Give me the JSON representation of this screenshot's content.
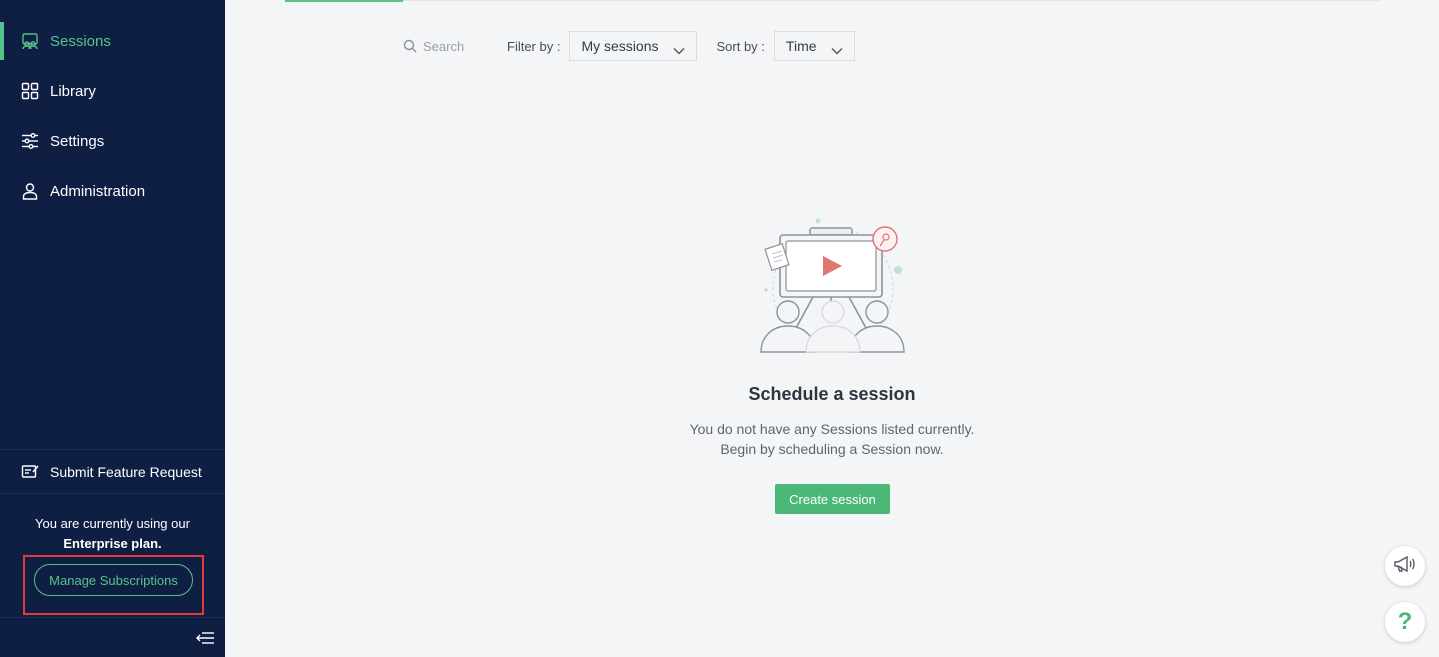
{
  "sidebar": {
    "items": [
      {
        "label": "Sessions",
        "icon": "sessions-icon",
        "active": true
      },
      {
        "label": "Library",
        "icon": "grid-icon",
        "active": false
      },
      {
        "label": "Settings",
        "icon": "sliders-icon",
        "active": false
      },
      {
        "label": "Administration",
        "icon": "user-icon",
        "active": false
      }
    ],
    "feature_request": "Submit Feature Request",
    "plan_line1": "You are currently using our",
    "plan_line2": "Enterprise plan.",
    "manage_button": "Manage Subscriptions"
  },
  "toolbar": {
    "search_placeholder": "Search",
    "filter_label": "Filter by :",
    "filter_value": "My sessions",
    "sort_label": "Sort by :",
    "sort_value": "Time"
  },
  "empty_state": {
    "title": "Schedule a session",
    "desc_line1": "You do not have any Sessions listed currently.",
    "desc_line2": "Begin by scheduling a Session now.",
    "button": "Create session"
  },
  "help": {
    "label": "?"
  },
  "colors": {
    "sidebar_bg": "#0f1f44",
    "accent": "#58c28a",
    "primary_button": "#4cb878",
    "highlight_frame": "#e5393b",
    "page_bg": "#f4f5f7"
  }
}
